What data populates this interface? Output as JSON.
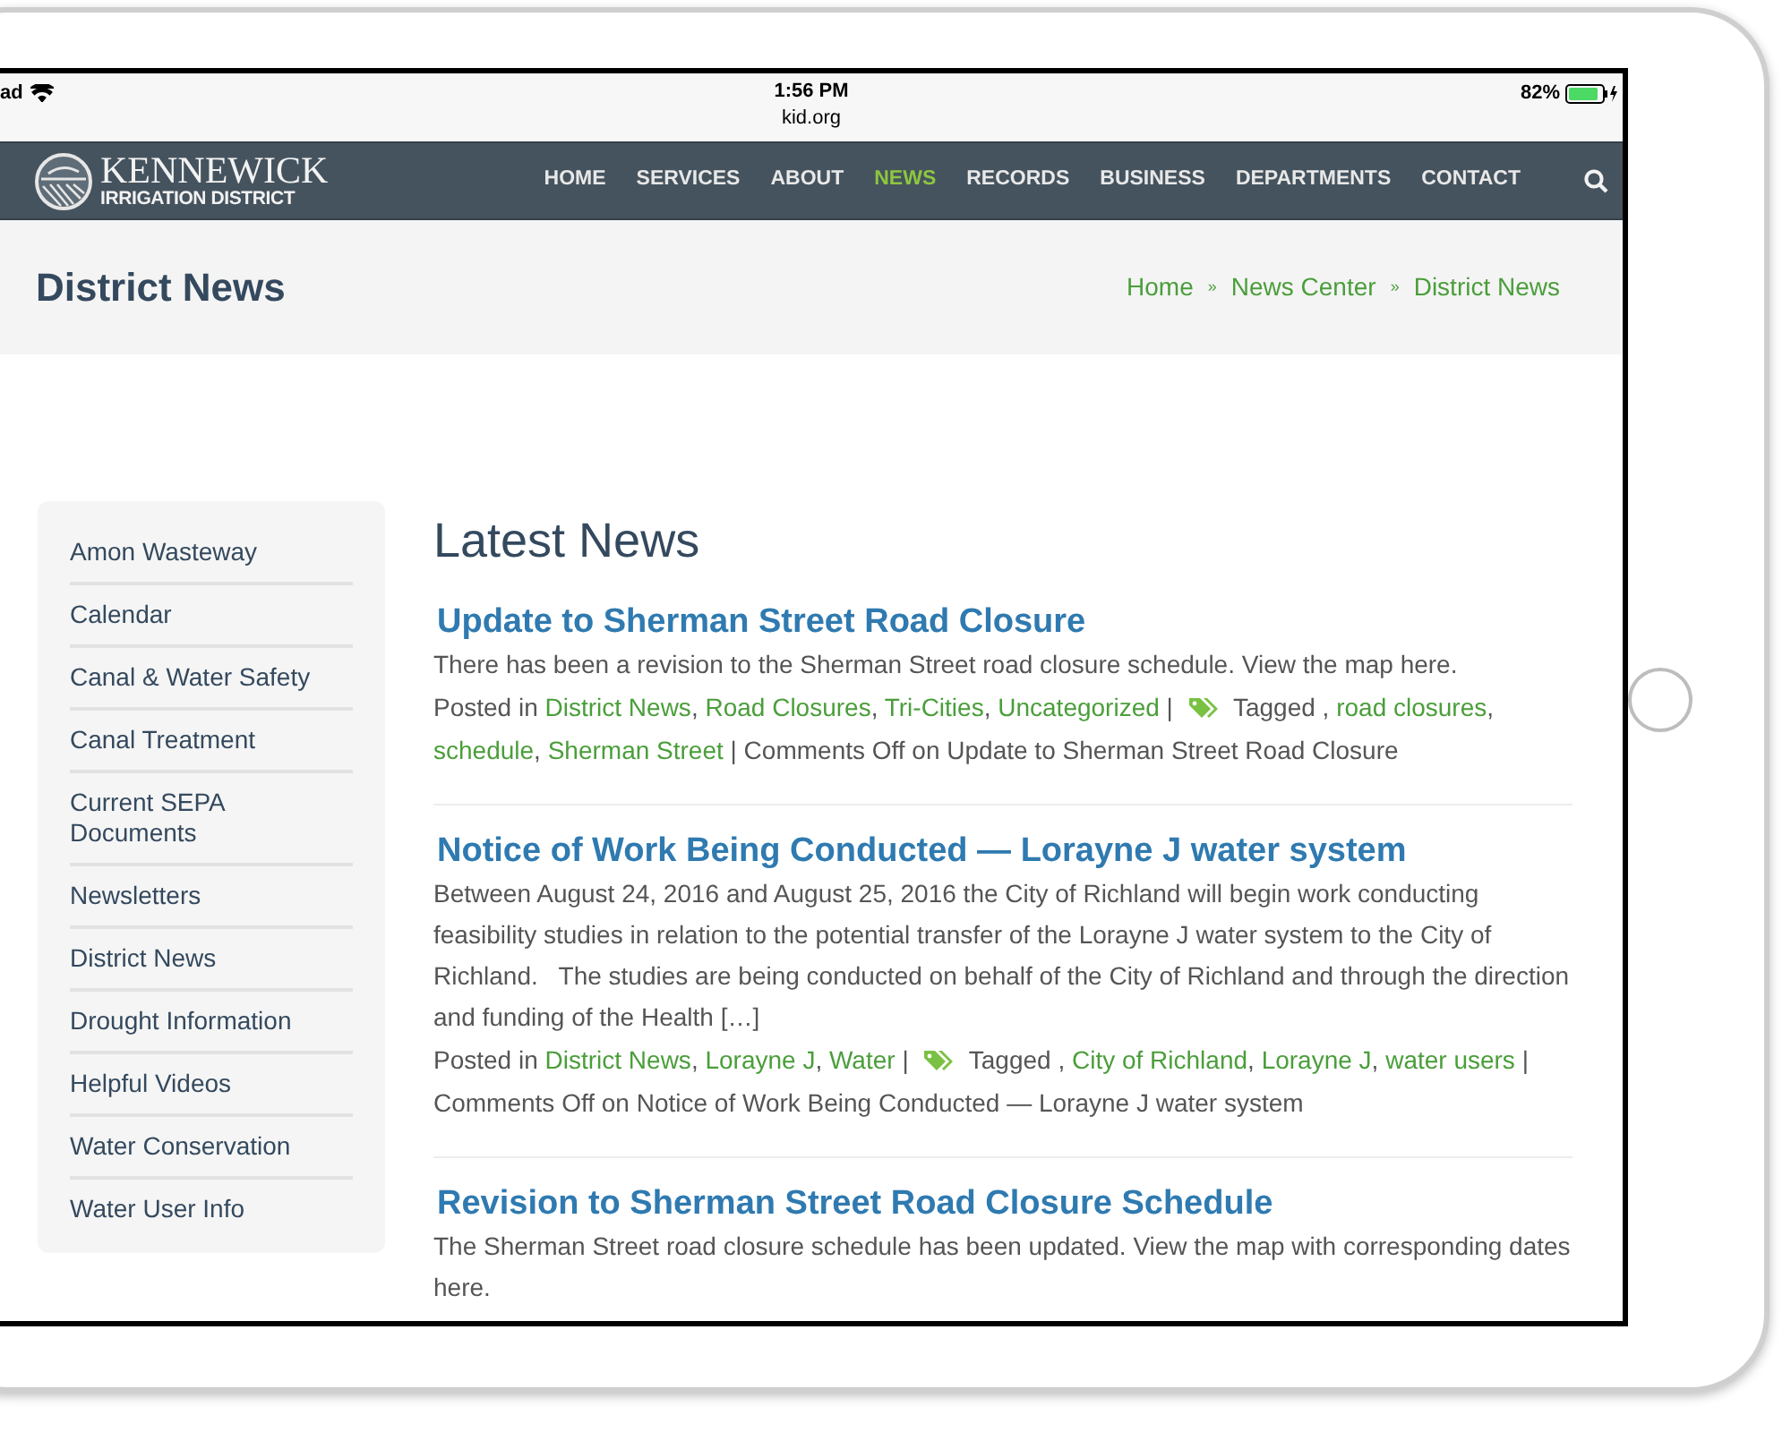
{
  "status_bar": {
    "device": "ad",
    "time": "1:56 PM",
    "url": "kid.org",
    "battery": "82%"
  },
  "logo": {
    "name": "KENNEWICK",
    "subtitle": "IRRIGATION DISTRICT"
  },
  "nav": [
    {
      "label": "HOME",
      "selected": false
    },
    {
      "label": "SERVICES",
      "selected": false
    },
    {
      "label": "ABOUT",
      "selected": false
    },
    {
      "label": "NEWS",
      "selected": true
    },
    {
      "label": "RECORDS",
      "selected": false
    },
    {
      "label": "BUSINESS",
      "selected": false
    },
    {
      "label": "DEPARTMENTS",
      "selected": false
    },
    {
      "label": "CONTACT",
      "selected": false
    }
  ],
  "page_title": "District News",
  "breadcrumbs": [
    {
      "kind": "link",
      "text": "Home"
    },
    {
      "kind": "separator",
      "text": "»"
    },
    {
      "kind": "link",
      "text": "News Center"
    },
    {
      "kind": "separator",
      "text": "»"
    },
    {
      "kind": "link",
      "text": "District News"
    }
  ],
  "sidebar": [
    "Amon Wasteway",
    "Calendar",
    "Canal & Water Safety",
    "Canal Treatment",
    "Current SEPA Documents",
    "Newsletters",
    "District News",
    "Drought Information",
    "Helpful Videos",
    "Water Conservation",
    "Water User Info"
  ],
  "heading": "Latest News",
  "posts": [
    {
      "title": "Update to Sherman Street Road Closure",
      "excerpt": "There has been a revision to the Sherman Street road closure schedule. View the map here.",
      "meta": [
        {
          "kind": "text",
          "text": "Posted in "
        },
        {
          "kind": "link",
          "text": "District News"
        },
        {
          "kind": "text",
          "text": ", "
        },
        {
          "kind": "link",
          "text": "Road Closures"
        },
        {
          "kind": "text",
          "text": ", "
        },
        {
          "kind": "link",
          "text": "Tri-Cities"
        },
        {
          "kind": "text",
          "text": ", "
        },
        {
          "kind": "link",
          "text": "Uncategorized"
        },
        {
          "kind": "text",
          "text": " | "
        },
        {
          "kind": "tag_icon"
        },
        {
          "kind": "text",
          "text": " Tagged , "
        },
        {
          "kind": "link",
          "text": "road closures"
        },
        {
          "kind": "text",
          "text": ", "
        },
        {
          "kind": "link",
          "text": "schedule"
        },
        {
          "kind": "text",
          "text": ", "
        },
        {
          "kind": "link",
          "text": "Sherman Street"
        },
        {
          "kind": "text",
          "text": " | Comments Off on Update to Sherman Street Road Closure"
        }
      ]
    },
    {
      "title": "Notice of Work Being Conducted — Lorayne J water system",
      "excerpt": "Between August 24, 2016 and August 25, 2016 the City of Richland will begin work conducting feasibility studies in relation to the potential transfer of the Lorayne J water system to the City of Richland.   The studies are being conducted on behalf of the City of Richland and through the direction and funding of the Health […]",
      "meta": [
        {
          "kind": "text",
          "text": "Posted in "
        },
        {
          "kind": "link",
          "text": "District News"
        },
        {
          "kind": "text",
          "text": ", "
        },
        {
          "kind": "link",
          "text": "Lorayne J"
        },
        {
          "kind": "text",
          "text": ", "
        },
        {
          "kind": "link",
          "text": "Water"
        },
        {
          "kind": "text",
          "text": " | "
        },
        {
          "kind": "tag_icon"
        },
        {
          "kind": "text",
          "text": " Tagged , "
        },
        {
          "kind": "link",
          "text": "City of Richland"
        },
        {
          "kind": "text",
          "text": ", "
        },
        {
          "kind": "link",
          "text": "Lorayne J"
        },
        {
          "kind": "text",
          "text": ", "
        },
        {
          "kind": "link",
          "text": "water users"
        },
        {
          "kind": "text",
          "text": " | Comments Off on Notice of Work Being Conducted — Lorayne J water system"
        }
      ]
    },
    {
      "title": "Revision to Sherman Street Road Closure Schedule",
      "excerpt": "The Sherman Street road closure schedule has been updated. View the map with corresponding dates here."
    }
  ]
}
